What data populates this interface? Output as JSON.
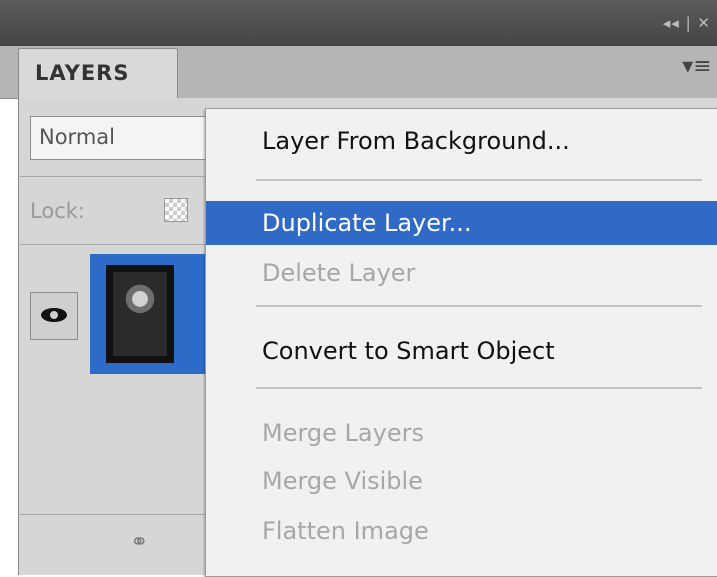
{
  "panel": {
    "tab_label": "LAYERS",
    "window_controls": "◂◂ | ✕",
    "blend_mode": "Normal",
    "lock_label": "Lock:",
    "panel_menu_icon": "panel-menu-icon"
  },
  "context_menu": {
    "items": [
      {
        "label": "Layer From Background...",
        "enabled": true
      },
      {
        "label": "Duplicate Layer...",
        "enabled": true,
        "highlighted": true
      },
      {
        "label": "Delete Layer",
        "enabled": false
      },
      {
        "label": "Convert to Smart Object",
        "enabled": true
      },
      {
        "label": "Merge Layers",
        "enabled": false
      },
      {
        "label": "Merge Visible",
        "enabled": false
      },
      {
        "label": "Flatten Image",
        "enabled": false
      }
    ]
  },
  "colors": {
    "highlight": "#3169c6",
    "selected_layer": "#2d6bc9",
    "disabled_text": "#a7a7a7"
  }
}
